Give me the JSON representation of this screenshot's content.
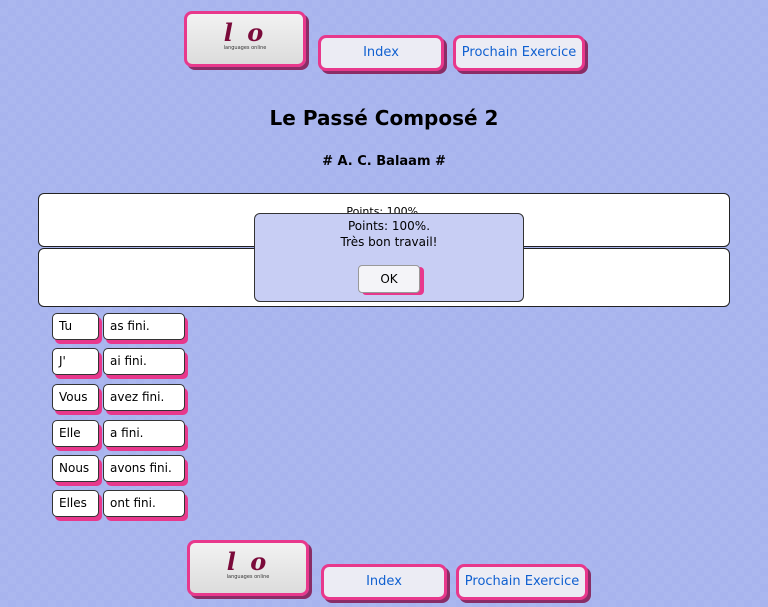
{
  "logo": {
    "mark": "l o",
    "tagline": "languages online"
  },
  "nav": {
    "index_label": "Index",
    "next_label": "Prochain Exercice"
  },
  "page": {
    "title": "Le Passé Composé 2",
    "author": "# A. C. Balaam #"
  },
  "feedback": {
    "score_text": "Points: 100%."
  },
  "dialog": {
    "line1": "Points: 100%.",
    "line2": "Très bon travail!",
    "ok_label": "OK"
  },
  "subjects": [
    "Tu",
    "J'",
    "Vous",
    "Elle",
    "Nous",
    "Elles"
  ],
  "verbs": [
    "as fini.",
    "ai fini.",
    "avez fini.",
    "a fini.",
    "avons fini.",
    "ont fini."
  ],
  "colors": {
    "accent": "#e8388c",
    "background": "#a8b4ee",
    "link": "#1060d0"
  }
}
